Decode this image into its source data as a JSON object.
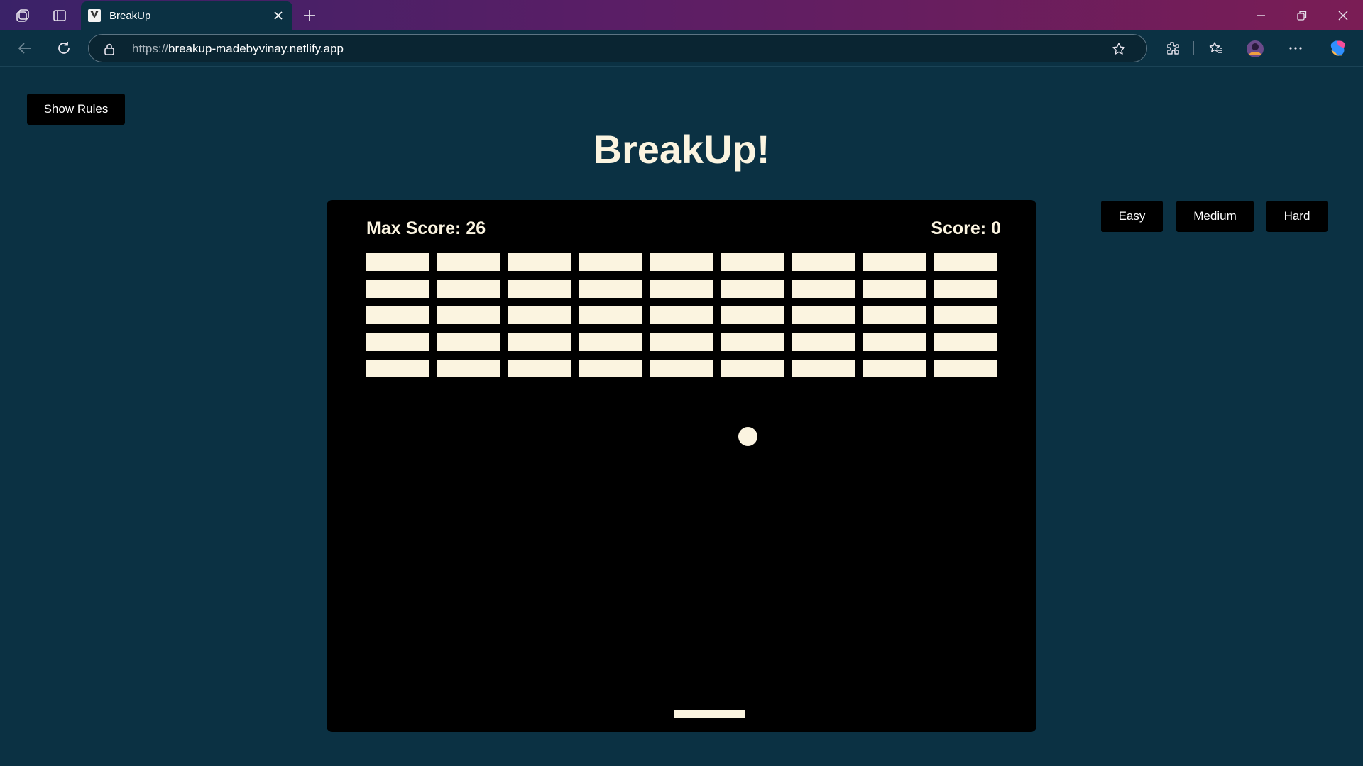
{
  "browser": {
    "tab_title": "BreakUp",
    "url_protocol": "https://",
    "url_host": "breakup-madebyvinay.netlify.app"
  },
  "page": {
    "show_rules_label": "Show Rules",
    "title": "BreakUp!",
    "difficulty": {
      "easy_label": "Easy",
      "medium_label": "Medium",
      "hard_label": "Hard"
    }
  },
  "game": {
    "max_score_text": "Max Score: 26",
    "score_text": "Score: 0",
    "brick_rows": 5,
    "brick_columns": 9,
    "colors": {
      "page_background": "#0b3143",
      "canvas_background": "#000000",
      "brick": "#fbf4e0",
      "ball": "#fbf4e0",
      "paddle": "#fbf4e0",
      "text": "#fbf4e0"
    }
  }
}
